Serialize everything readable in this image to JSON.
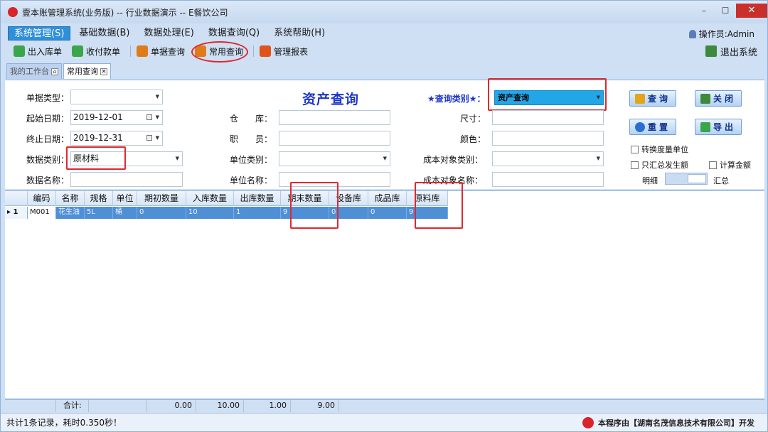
{
  "window": {
    "title": "壹本账管理系统(业务版) -- 行业数据演示 -- E餐饮公司",
    "min": "–",
    "max": "☐",
    "close": "✕"
  },
  "menu": [
    {
      "label": "系统管理(S)"
    },
    {
      "label": "基础数据(B)"
    },
    {
      "label": "数据处理(E)"
    },
    {
      "label": "数据查询(Q)"
    },
    {
      "label": "系统帮助(H)"
    }
  ],
  "operator": "操作员:Admin",
  "toolbar": [
    {
      "label": "出入库单",
      "color": "#3aa64a"
    },
    {
      "label": "收付款单",
      "color": "#3aa64a"
    },
    {
      "label": "单据查询",
      "color": "#e07b1a"
    },
    {
      "label": "常用查询",
      "color": "#e07b1a"
    },
    {
      "label": "管理报表",
      "color": "#e0531a"
    }
  ],
  "exit_label": "退出系统",
  "tabs": [
    {
      "label": "我的工作台"
    },
    {
      "label": "常用查询"
    }
  ],
  "form": {
    "title": "资产查询",
    "doc_type_label": "单据类型：",
    "doc_type_value": "",
    "start_date_label": "起始日期：",
    "start_date_value": "2019-12-01",
    "end_date_label": "终止日期：",
    "end_date_value": "2019-12-31",
    "data_category_label": "数据类别：",
    "data_category_value": "原材料",
    "data_name_label": "数据名称：",
    "data_name_value": "",
    "warehouse_label": "仓　　库：",
    "staff_label": "职　　员：",
    "unit_category_label": "单位类别：",
    "unit_name_label": "单位名称：",
    "query_type_label": "★查询类别★：",
    "query_type_value": "资产查询",
    "size_label": "尺寸：",
    "color_label": "颜色：",
    "cost_obj_cat_label": "成本对象类别：",
    "cost_obj_name_label": "成本对象名称："
  },
  "buttons": {
    "query": "查询",
    "close": "关闭",
    "reset": "重置",
    "export": "导出"
  },
  "options": {
    "convert_unit": "转换度量单位",
    "only_summary": "只汇总发生额",
    "calc_amount": "计算金额",
    "detail": "明细",
    "summary": "汇总"
  },
  "grid": {
    "columns": [
      "编码",
      "名称",
      "规格",
      "单位",
      "期初数量",
      "入库数量",
      "出库数量",
      "期末数量",
      "设备库",
      "成品库",
      "原料库"
    ],
    "rows": [
      {
        "index": "1",
        "cells": [
          "M001",
          "花生油",
          "5L",
          "桶",
          "0",
          "10",
          "1",
          "9",
          "0",
          "0",
          "9"
        ]
      }
    ]
  },
  "totals": {
    "label": "合计:",
    "opening": "0.00",
    "inbound": "10.00",
    "outbound": "1.00",
    "closing": "9.00"
  },
  "status": {
    "left": "共计1条记录，耗时0.350秒！",
    "right": "本程序由【湖南名茂信息技术有限公司】开发"
  }
}
